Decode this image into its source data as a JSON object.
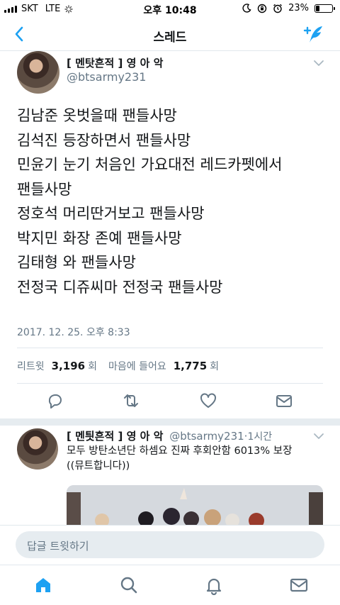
{
  "status_bar": {
    "carrier": "SKT",
    "network": "LTE",
    "time": "오후 10:48",
    "battery_percent": "23%",
    "battery_level": 0.23
  },
  "nav": {
    "title": "스레드",
    "back_icon": "chevron-left-icon",
    "compose_icon": "compose-tweet-icon",
    "accent_color": "#1da1f2"
  },
  "tweet": {
    "display_name": "[ 멘탓흔적 ] 영 아 악",
    "handle": "@btsarmy231",
    "text": "김남준 옷벗을때 팬들사망\n김석진 등장하면서 팬들사망\n민윤기  눈기 처음인  가요대전 레드카펫에서\n팬들사망\n정호석 머리딴거보고 팬들사망\n박지민 화장 존예 팬들사망\n김태형 와 팬들사망\n전정국 디쥬씨마 전정국 팬들사망",
    "timestamp": "2017. 12. 25. 오후 8:33",
    "retweets_label": "리트윗",
    "retweets_count": "3,196",
    "retweets_unit": "회",
    "likes_label": "마음에 들어요",
    "likes_count": "1,775",
    "likes_unit": "회"
  },
  "reply": {
    "display_name": "[ 멘틧흔적 ] 영 아 악",
    "handle": "@btsarmy231",
    "separator": "·",
    "age": "1시간",
    "text": "모두 방탄소년단 하셈요 진짜 후회안함 6013% 보장\n((뮤트합니다))"
  },
  "composer": {
    "placeholder": "답글 트윗하기"
  },
  "tabbar": {
    "items": [
      "home-icon",
      "search-icon",
      "notifications-icon",
      "messages-icon"
    ]
  }
}
